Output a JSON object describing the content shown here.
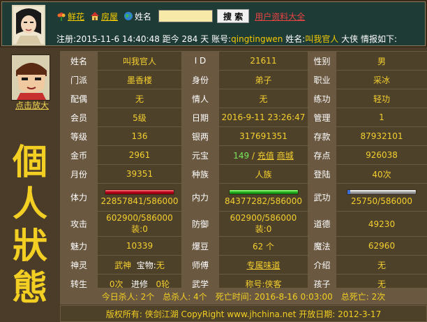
{
  "nav": {
    "flower": "鲜花",
    "house": "房屋",
    "name_label": "姓名",
    "search_value": "",
    "search_button": "搜 索",
    "userlist": "用户资料大全"
  },
  "info": {
    "prefix": "注册:",
    "reg_date": "2015-11-6 14:40:48",
    "days_label": "距今",
    "days": "284",
    "days_unit": "天",
    "account_label": "账号:",
    "account": "qingtingwen",
    "name_label": "姓名:",
    "name": "叫我官人",
    "suffix": "大侠 情报如下:"
  },
  "sidebar": {
    "zoom": "点击放大",
    "title": [
      "個",
      "人",
      "狀",
      "態"
    ]
  },
  "grid": {
    "r1": {
      "l1": "姓名",
      "v1": "叫我官人",
      "l2": "I D",
      "v2": "21611",
      "l3": "性别",
      "v3": "男"
    },
    "r2": {
      "l1": "门派",
      "v1": "墨香楼",
      "l2": "身份",
      "v2": "弟子",
      "l3": "职业",
      "v3": "采冰"
    },
    "r3": {
      "l1": "配偶",
      "v1": "无",
      "l2": "情人",
      "v2": "无",
      "l3": "练功",
      "v3": "轻功"
    },
    "r4": {
      "l1": "会员",
      "v1": "5级",
      "l2": "日期",
      "v2": "2016-9-11 23:26:47",
      "l3": "管理",
      "v3": "1"
    },
    "r5": {
      "l1": "等级",
      "v1": "136",
      "l2": "银两",
      "v2": "317691351",
      "l3": "存款",
      "v3": "87932101"
    },
    "r6": {
      "l1": "金币",
      "v1": "2961",
      "l2": "元宝",
      "v2_num": "149",
      "v2_sep": "/",
      "v2_a": "充值",
      "v2_b": "商城",
      "l3": "存点",
      "v3": "926038"
    },
    "r7": {
      "l1": "月份",
      "v1": "39351",
      "l2": "种族",
      "v2": "人族",
      "l3": "登陆",
      "v3": "40次"
    },
    "r8": {
      "l1": "体力",
      "v1": "22857841/586000",
      "l2": "内力",
      "v2": "84377282/586000",
      "l3": "武功",
      "v3": "25750/586000"
    },
    "r9": {
      "l1": "攻击",
      "v1a": "602900/586000",
      "v1b": "装:0",
      "l2": "防御",
      "v2a": "602900/586000",
      "v2b": "装:0",
      "l3": "道德",
      "v3": "49230"
    },
    "r10": {
      "l1": "魅力",
      "v1": "10339",
      "l2": "爆豆",
      "v2": "62 个",
      "l3": "魔法",
      "v3": "62960"
    },
    "r11": {
      "l1": "神灵",
      "v1a": "武神",
      "v1b_label": "宝物:",
      "v1b": "无",
      "l2": "师傅",
      "v2": "专属味道",
      "l3": "介绍",
      "v3": "无"
    },
    "r12": {
      "l1": "转生",
      "c1": "0次",
      "c2": "进修",
      "c3": "0轮",
      "l2": "武学",
      "v2": "称号:侠客",
      "l3": "孩子",
      "v3": "无"
    }
  },
  "bars": {
    "hp": 1.0,
    "mp": 1.0,
    "skill": 0.044
  },
  "summary": {
    "today_kills": "今日杀人: 2个",
    "total_kills": "总杀人: 4个",
    "death_time": "死亡时间: 2016-8-16 0:03:00",
    "total_deaths": "总死亡: 2次"
  },
  "footer": {
    "copyright": "版权所有: 侠剑江湖 CopyRight www.jhchina.net 开放日期: 2012-3-17"
  }
}
